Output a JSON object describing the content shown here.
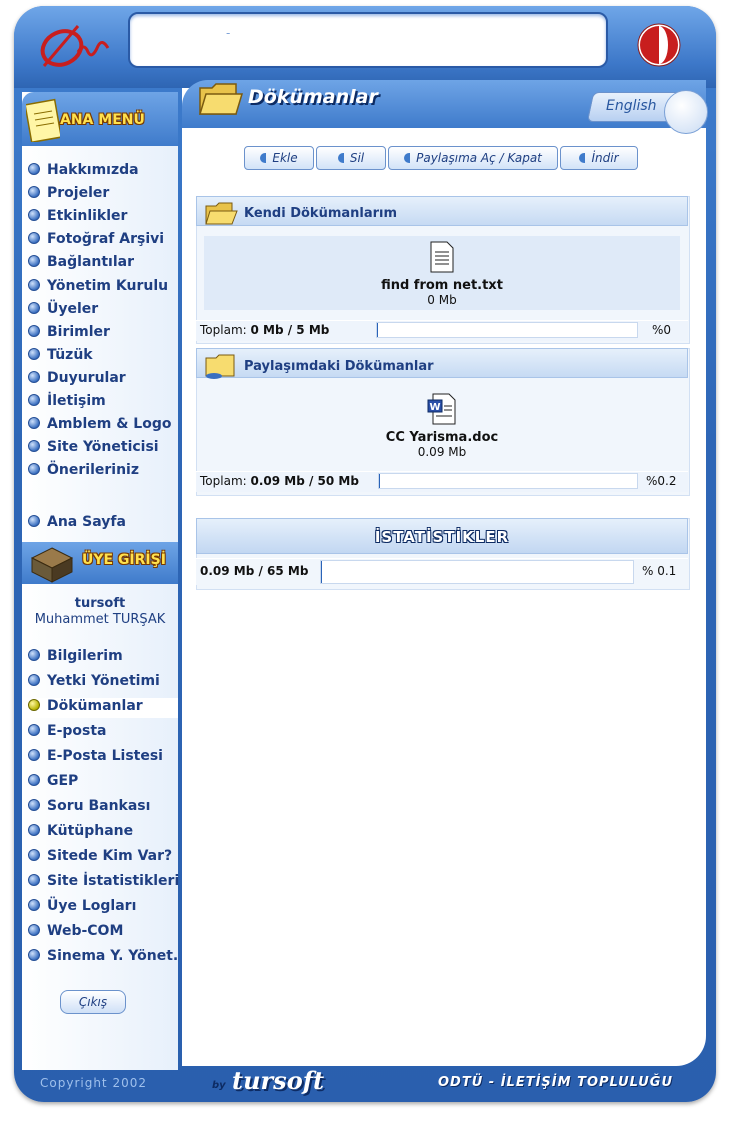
{
  "header": {
    "title_text": "-"
  },
  "sidebar": {
    "menu_title": "ANA MENÜ",
    "items": [
      "Hakkımızda",
      "Projeler",
      "Etkinlikler",
      "Fotoğraf Arşivi",
      "Bağlantılar",
      "Yönetim Kurulu",
      "Üyeler",
      "Birimler",
      "Tüzük",
      "Duyurular",
      "İletişim",
      "Amblem & Logo",
      "Site Yöneticisi",
      "Önerileriniz"
    ],
    "home": "Ana Sayfa",
    "member_title": "ÜYE GİRİŞİ",
    "username": "tursoft",
    "fullname": "Muhammet TURŞAK",
    "member_items": [
      "Bilgilerim",
      "Yetki Yönetimi",
      "Dökümanlar",
      "E-posta",
      "E-Posta Listesi",
      "GEP",
      "Soru Bankası",
      "Kütüphane",
      "Sitede Kim Var?",
      "Site İstatistikleri",
      "Üye Logları",
      "Web-COM",
      "Sinema Y. Yönet."
    ],
    "active_member_item": "Dökümanlar",
    "logout": "Çıkış"
  },
  "main": {
    "title": "Dökümanlar",
    "language": "English",
    "toolbar": {
      "add": "Ekle",
      "delete": "Sil",
      "share": "Paylaşıma Aç / Kapat",
      "download": "İndir"
    },
    "my_docs": {
      "title": "Kendi Dökümanlarım",
      "file_name": "find from net.txt",
      "file_size": "0 Mb",
      "total_label": "Toplam:",
      "total_value": "0 Mb / 5 Mb",
      "percent": "%0",
      "fill": 0.0
    },
    "shared_docs": {
      "title": "Paylaşımdaki Dökümanlar",
      "file_name": "CC Yarisma.doc",
      "file_size": "0.09 Mb",
      "total_label": "Toplam:",
      "total_value": "0.09 Mb / 50 Mb",
      "percent": "%0.2",
      "fill": 0.002
    },
    "stats": {
      "title": "İSTATİSTİKLER",
      "value": "0.09 Mb / 65 Mb",
      "percent": "% 0.1",
      "fill": 0.001
    }
  },
  "footer": {
    "copyright": "Copyright 2002",
    "by": "by",
    "brand": "tursoft",
    "org": "ODTÜ - İLETİŞİM TOPLULUĞU"
  }
}
